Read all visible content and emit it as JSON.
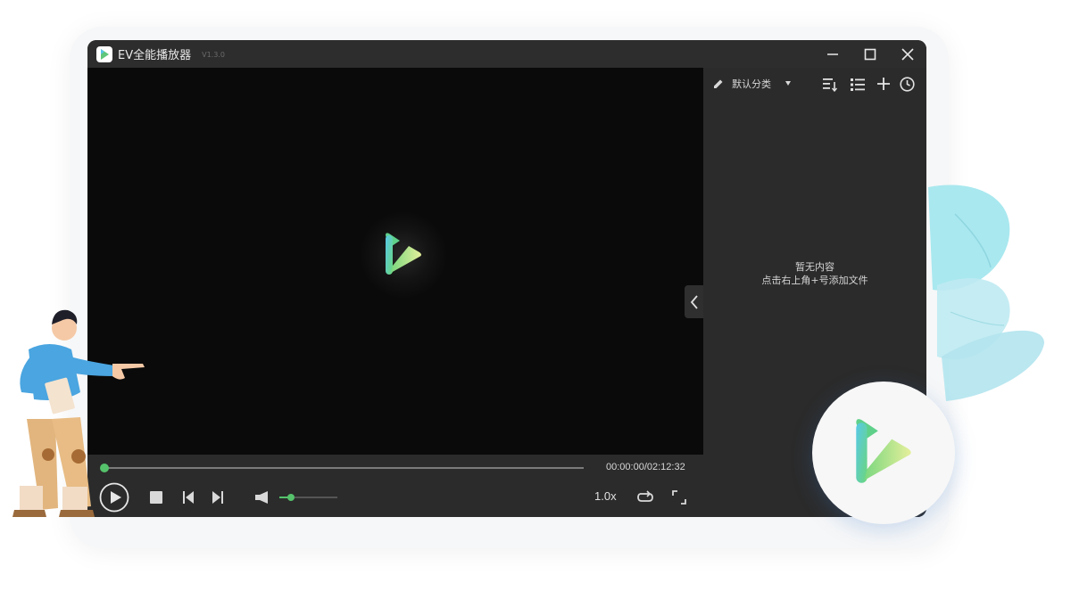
{
  "app": {
    "title": "EV全能播放器",
    "version": "V1.3.0"
  },
  "window_controls": {
    "minimize_icon": "minimize-icon",
    "maximize_icon": "maximize-icon",
    "close_icon": "close-icon"
  },
  "player": {
    "current_time": "00:00:00",
    "total_time": "02:12:32",
    "time_display": "00:00:00/02:12:32",
    "progress": 0,
    "volume": 0.2,
    "speed": "1.0x"
  },
  "playlist": {
    "category": "默认分类",
    "empty_title": "暂无内容",
    "empty_hint": "点击右上角+号添加文件"
  },
  "colors": {
    "accent": "#55c26b",
    "titlebar": "#2d2d2d",
    "panel": "#2b2b2b",
    "video_bg": "#0a0a0a"
  }
}
